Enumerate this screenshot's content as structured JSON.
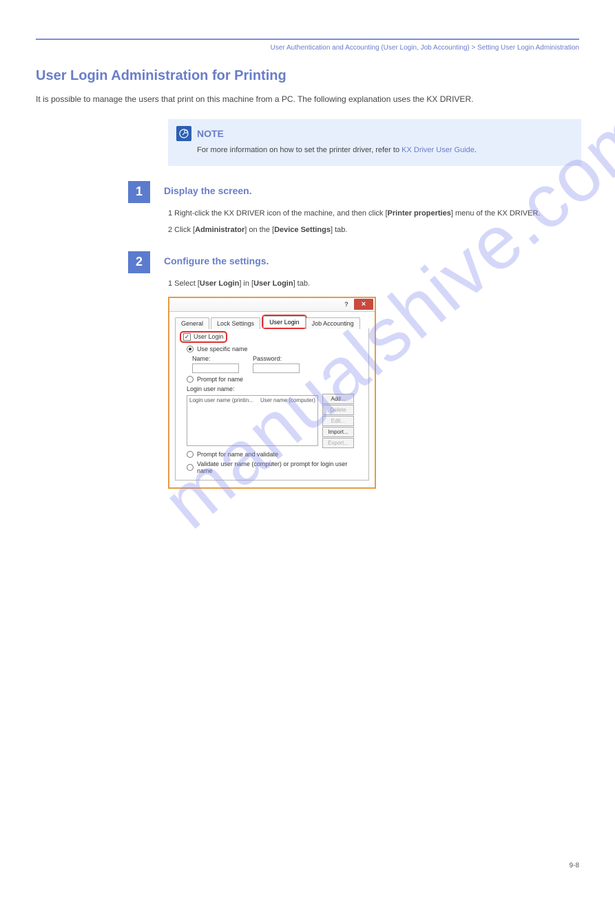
{
  "header": {
    "breadcrumb": "User Authentication and Accounting (User Login, Job Accounting) > Setting User Login Administration"
  },
  "section": {
    "title": "User Login Administration for Printing",
    "lead": "It is possible to manage the users that print on this machine from a PC. The following explanation uses the KX DRIVER."
  },
  "note": {
    "heading": "NOTE",
    "body_prefix": "For more information on how to set the printer driver, refer to ",
    "body_link": "KX Driver User Guide",
    "body_suffix": "."
  },
  "steps": {
    "num1": "1",
    "title1": "Display the screen.",
    "sub1_prefix": "1 Right-click the KX DRIVER icon of the machine, and then click [",
    "sub1_bold": "Printer properties",
    "sub1_suffix": "] menu of the KX DRIVER.",
    "sub2_prefix": "2 Click [",
    "sub2_bold1": "Administrator",
    "sub2_mid": "] on the [",
    "sub2_bold2": "Device Settings",
    "sub2_suffix": "] tab.",
    "num2": "2",
    "title2": "Configure the settings.",
    "sub3_prefix": "1 Select [",
    "sub3_bold1": "User Login",
    "sub3_mid": "] in [",
    "sub3_bold2": "User Login",
    "sub3_suffix": "] tab."
  },
  "dialog": {
    "help": "?",
    "close": "×",
    "tabs": {
      "general": "General",
      "lock": "Lock Settings",
      "userlogin": "User Login",
      "job": "Job Accounting"
    },
    "chk_userlogin": "User Login",
    "radio_specific": "Use specific name",
    "label_name": "Name:",
    "label_password": "Password:",
    "radio_prompt": "Prompt for name",
    "label_loginlist": "Login user name:",
    "col1": "Login user name (printin...",
    "col2": "User name (computer)",
    "btn_add": "Add...",
    "btn_delete": "Delete",
    "btn_edit": "Edit...",
    "btn_import": "Import...",
    "btn_export": "Export...",
    "radio_prompt_validate": "Prompt for name and validate",
    "radio_validate": "Validate user name (computer) or prompt for login user name"
  },
  "footer": {
    "page": "9-8"
  },
  "watermark": "manualshive.com"
}
